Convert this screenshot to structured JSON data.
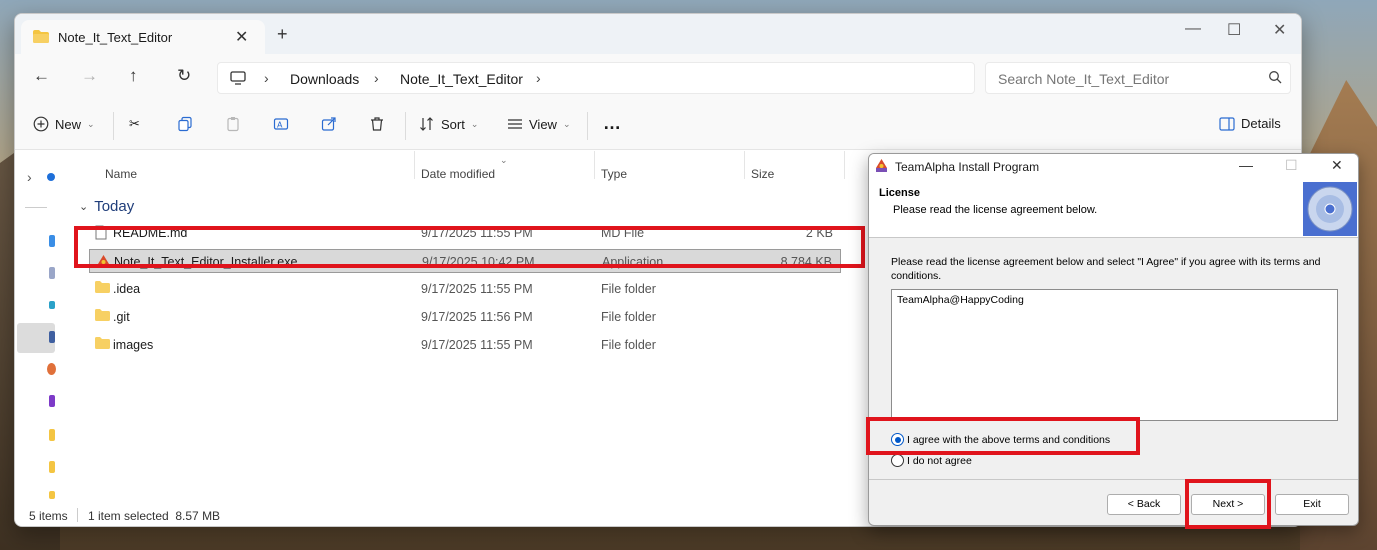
{
  "explorer": {
    "tab_title": "Note_It_Text_Editor",
    "breadcrumb": [
      "Downloads",
      "Note_It_Text_Editor"
    ],
    "search_placeholder": "Search Note_It_Text_Editor",
    "toolbar": {
      "new": "New",
      "sort": "Sort",
      "view": "View",
      "more": "…",
      "details": "Details"
    },
    "columns": [
      "Name",
      "Date modified",
      "Type",
      "Size"
    ],
    "group": "Today",
    "files": [
      {
        "name": "README.md",
        "date": "9/17/2025 11:55 PM",
        "type": "MD File",
        "size": "2 KB",
        "icon": "document-icon"
      },
      {
        "name": "Note_It_Text_Editor_Installer.exe",
        "date": "9/17/2025 10:42 PM",
        "type": "Application",
        "size": "8,784 KB",
        "icon": "installer-icon",
        "selected": true
      },
      {
        "name": ".idea",
        "date": "9/17/2025 11:55 PM",
        "type": "File folder",
        "size": "",
        "icon": "folder-icon"
      },
      {
        "name": ".git",
        "date": "9/17/2025 11:56 PM",
        "type": "File folder",
        "size": "",
        "icon": "folder-icon"
      },
      {
        "name": "images",
        "date": "9/17/2025 11:55 PM",
        "type": "File folder",
        "size": "",
        "icon": "folder-icon"
      }
    ],
    "status": {
      "items": "5 items",
      "selection": "1 item selected  8.57 MB"
    }
  },
  "installer": {
    "title": "TeamAlpha Install Program",
    "header_title": "License",
    "header_subtitle": "Please read the license agreement below.",
    "instructions": "Please read the license agreement below and select \"I Agree\" if you agree with its terms and conditions.",
    "license_text": "TeamAlpha@HappyCoding",
    "agree_label": "I agree with the above terms and conditions",
    "disagree_label": "I do not agree",
    "agree_selected": true,
    "back_label": "< Back",
    "next_label": "Next >",
    "exit_label": "Exit"
  },
  "colors": {
    "highlight": "#e0141c",
    "radio_accent": "#0057c8"
  }
}
